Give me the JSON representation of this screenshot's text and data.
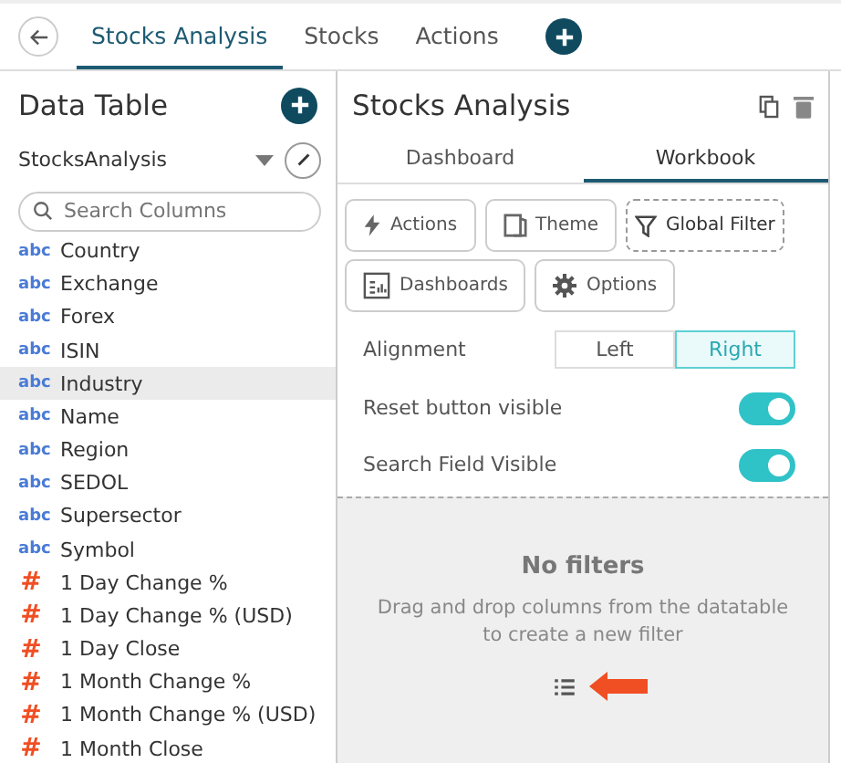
{
  "top_tabs": [
    {
      "label": "Stocks Analysis",
      "selected": true
    },
    {
      "label": "Stocks",
      "selected": false
    },
    {
      "label": "Actions",
      "selected": false
    }
  ],
  "data_table": {
    "title": "Data Table",
    "source": "StocksAnalysis",
    "search": {
      "placeholder": "Search Columns"
    },
    "columns": [
      {
        "type_label": "abc",
        "kind": "text",
        "name": "Country",
        "selected": false
      },
      {
        "type_label": "abc",
        "kind": "text",
        "name": "Exchange",
        "selected": false
      },
      {
        "type_label": "abc",
        "kind": "text",
        "name": "Forex",
        "selected": false
      },
      {
        "type_label": "abc",
        "kind": "text",
        "name": "ISIN",
        "selected": false
      },
      {
        "type_label": "abc",
        "kind": "text",
        "name": "Industry",
        "selected": true
      },
      {
        "type_label": "abc",
        "kind": "text",
        "name": "Name",
        "selected": false
      },
      {
        "type_label": "abc",
        "kind": "text",
        "name": "Region",
        "selected": false
      },
      {
        "type_label": "abc",
        "kind": "text",
        "name": "SEDOL",
        "selected": false
      },
      {
        "type_label": "abc",
        "kind": "text",
        "name": "Supersector",
        "selected": false
      },
      {
        "type_label": "abc",
        "kind": "text",
        "name": "Symbol",
        "selected": false
      },
      {
        "type_label": "#",
        "kind": "number",
        "name": "1 Day Change %",
        "selected": false
      },
      {
        "type_label": "#",
        "kind": "number",
        "name": "1 Day Change % (USD)",
        "selected": false
      },
      {
        "type_label": "#",
        "kind": "number",
        "name": "1 Day Close",
        "selected": false
      },
      {
        "type_label": "#",
        "kind": "number",
        "name": "1 Month Change %",
        "selected": false
      },
      {
        "type_label": "#",
        "kind": "number",
        "name": "1 Month Change % (USD)",
        "selected": false
      },
      {
        "type_label": "#",
        "kind": "number",
        "name": "1 Month Close",
        "selected": false
      }
    ]
  },
  "panel": {
    "title": "Stocks Analysis",
    "tabs": [
      {
        "label": "Dashboard",
        "selected": false
      },
      {
        "label": "Workbook",
        "selected": true
      }
    ],
    "tools": [
      {
        "label": "Actions",
        "kind": "bolt",
        "selected": false
      },
      {
        "label": "Theme",
        "kind": "theme",
        "selected": false
      },
      {
        "label": "Global Filter",
        "kind": "filter",
        "selected": true
      },
      {
        "label": "Dashboards",
        "kind": "dashboards",
        "selected": false
      },
      {
        "label": "Options",
        "kind": "gear",
        "selected": false
      }
    ],
    "alignment": {
      "label": "Alignment",
      "options": [
        {
          "label": "Left",
          "selected": false
        },
        {
          "label": "Right",
          "selected": true
        }
      ]
    },
    "toggles": [
      {
        "label": "Reset button visible",
        "on": true
      },
      {
        "label": "Search Field Visible",
        "on": true
      }
    ],
    "empty": {
      "title": "No filters",
      "message": "Drag and drop columns from the datatable to create a new filter"
    }
  }
}
